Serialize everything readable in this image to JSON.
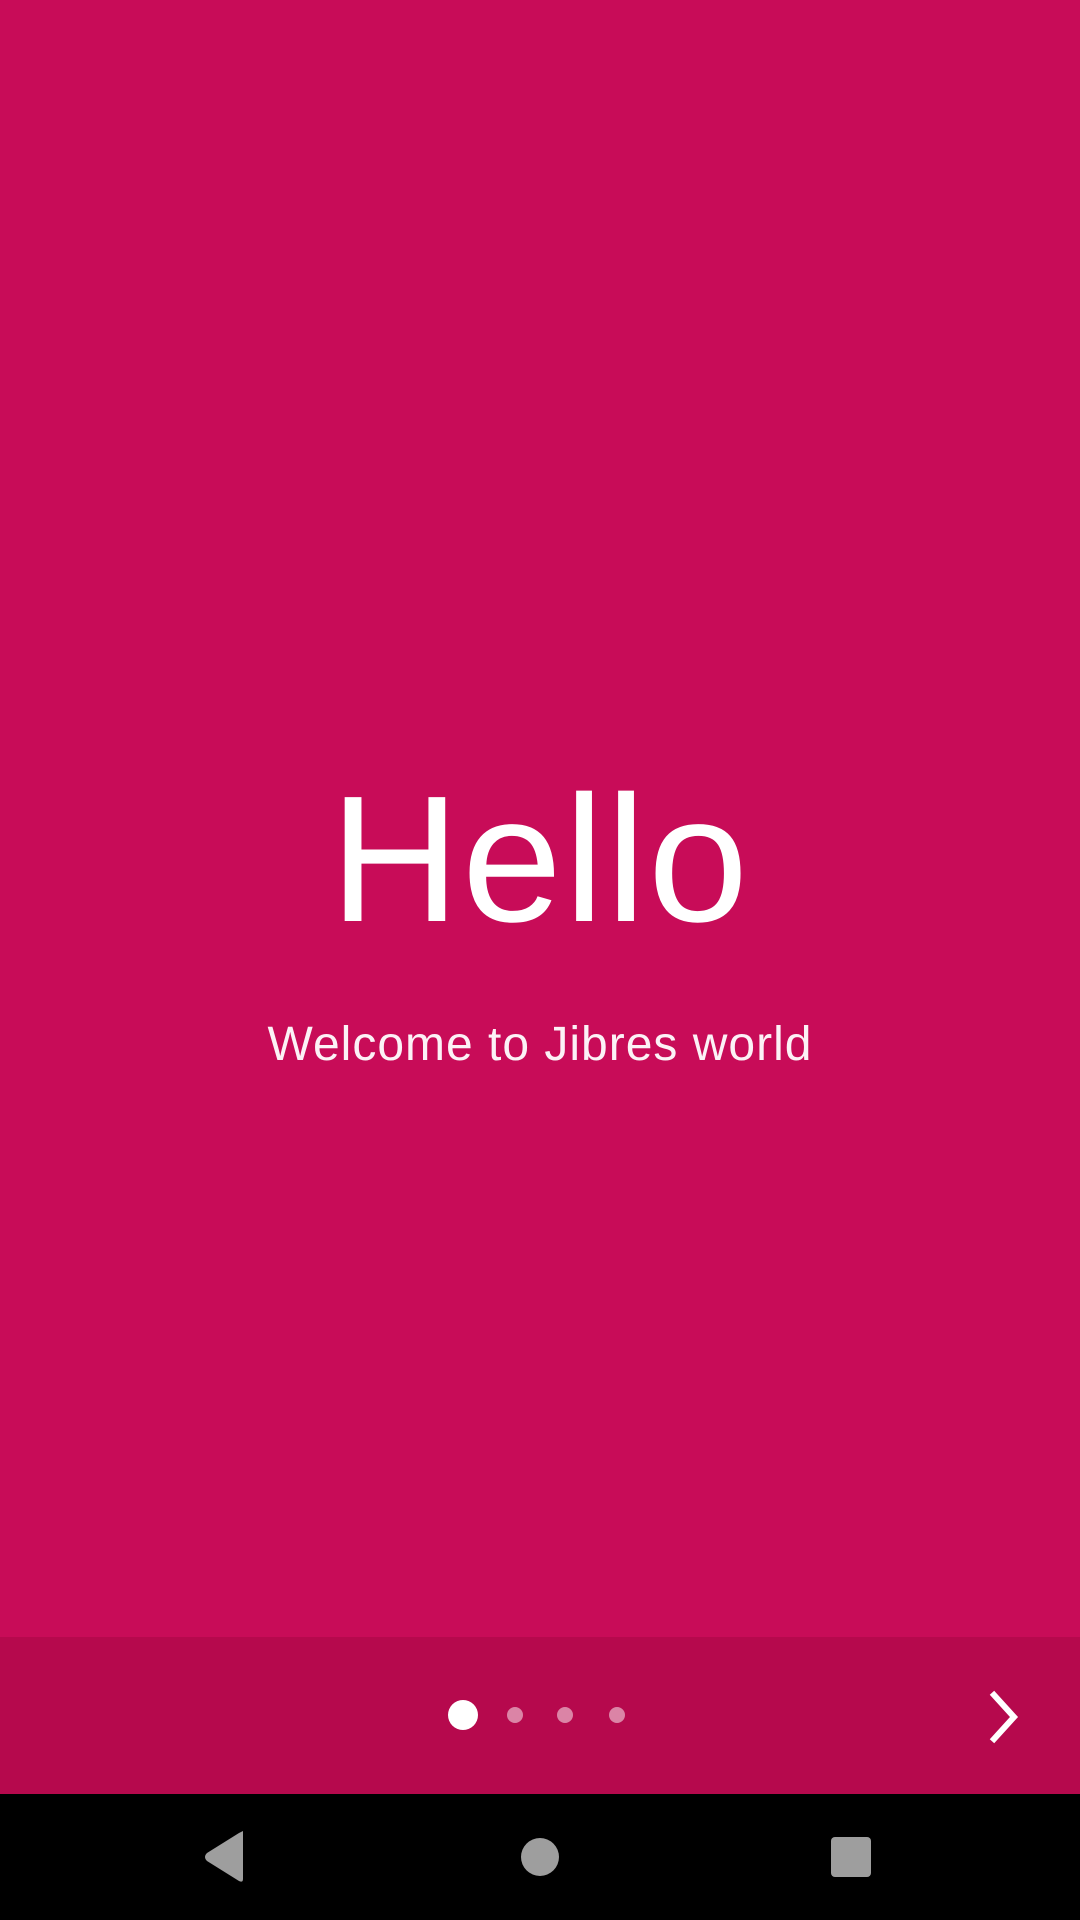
{
  "intro": {
    "title": "Hello",
    "subtitle": "Welcome to Jibres world",
    "background_color": "#C80C58"
  },
  "pager": {
    "page_count": 4,
    "current_page": 1,
    "bar_color": "#B6094D",
    "next_icon": "chevron-right-icon"
  },
  "system_nav": {
    "back_icon": "back-triangle-icon",
    "home_icon": "home-circle-icon",
    "recents_icon": "recents-square-icon"
  }
}
